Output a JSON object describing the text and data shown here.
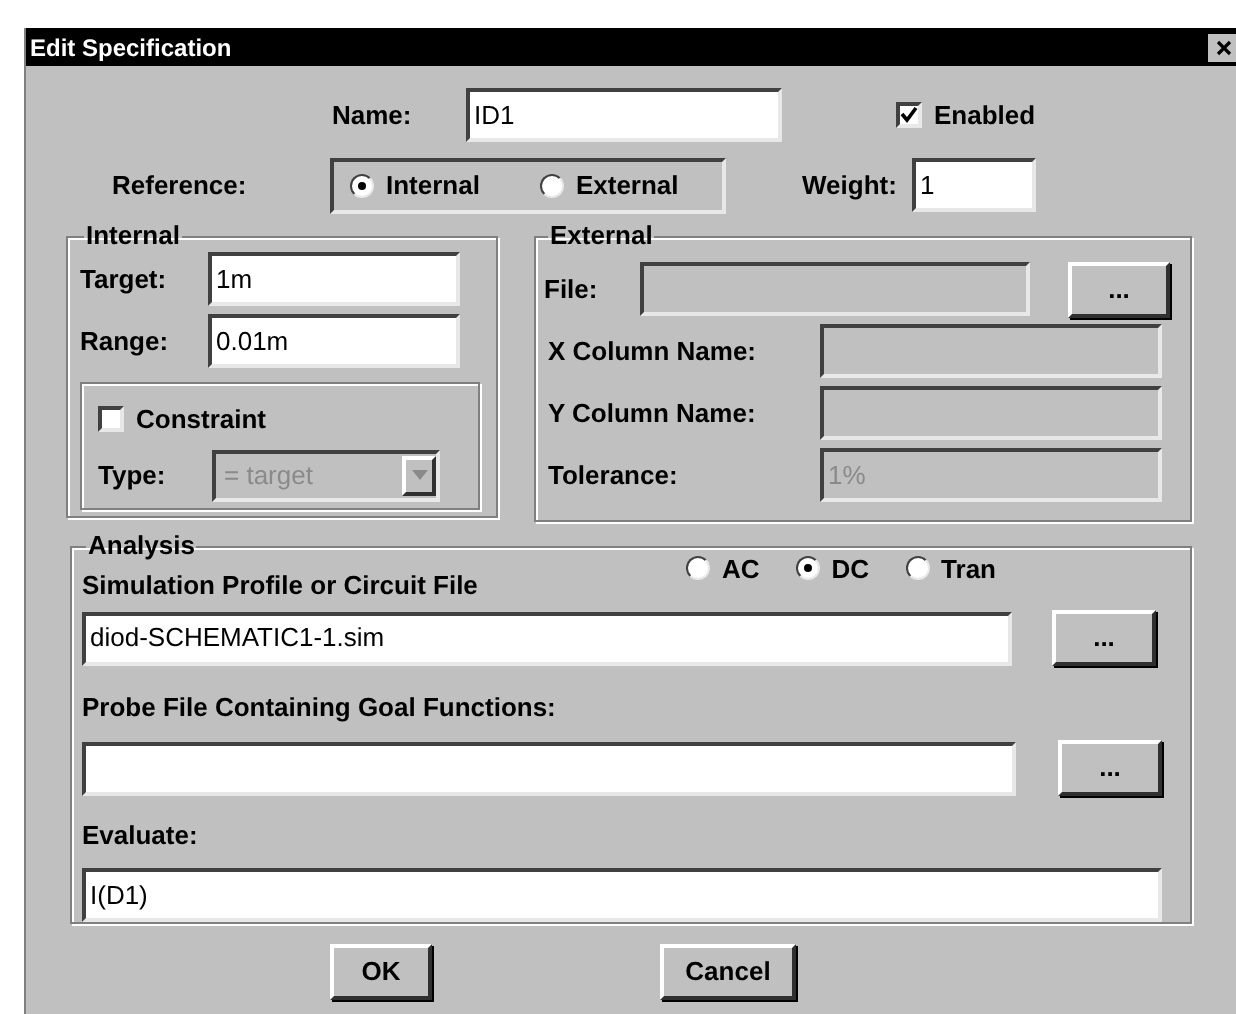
{
  "window": {
    "title": "Edit Specification"
  },
  "name": {
    "label": "Name:",
    "value": "ID1"
  },
  "enabled": {
    "label": "Enabled",
    "checked": true
  },
  "reference": {
    "label": "Reference:",
    "options": [
      {
        "label": "Internal",
        "selected": true
      },
      {
        "label": "External",
        "selected": false
      }
    ]
  },
  "weight": {
    "label": "Weight:",
    "value": "1"
  },
  "internal": {
    "title": "Internal",
    "target": {
      "label": "Target:",
      "value": "1m"
    },
    "range": {
      "label": "Range:",
      "value": "0.01m"
    },
    "constraint": {
      "label": "Constraint",
      "checked": false
    },
    "type": {
      "label": "Type:",
      "value": "= target",
      "disabled": true
    }
  },
  "external": {
    "title": "External",
    "file": {
      "label": "File:",
      "disabled": true,
      "browse": "..."
    },
    "fields": [
      {
        "label": "X Column Name:",
        "disabled": true
      },
      {
        "label": "Y Column Name:",
        "disabled": true
      },
      {
        "label": "Tolerance:",
        "value": "1%",
        "disabled": true
      }
    ]
  },
  "analysis": {
    "title": "Analysis",
    "modes": [
      {
        "label": "AC",
        "selected": false
      },
      {
        "label": "DC",
        "selected": true
      },
      {
        "label": "Tran",
        "selected": false
      }
    ],
    "profile": {
      "label": "Simulation Profile or Circuit File",
      "value": "diod-SCHEMATIC1-1.sim",
      "browse": "..."
    },
    "probe": {
      "label": "Probe File Containing Goal Functions:",
      "browse": "..."
    },
    "evaluate": {
      "label": "Evaluate:",
      "value": "I(D1)"
    }
  },
  "buttons": [
    "OK",
    "Cancel"
  ]
}
